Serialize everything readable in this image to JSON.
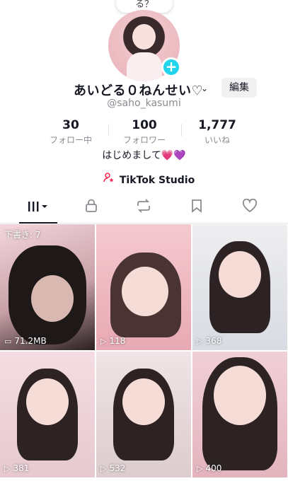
{
  "speech_bubble": "る？",
  "profile": {
    "display_name": "あいどる０ねんせい♡",
    "edit_label": "編集",
    "username": "@saho_kasumi",
    "bio_text": "はじめまして",
    "bio_heart1": "💗",
    "bio_heart2": "💜"
  },
  "stats": [
    {
      "value": "30",
      "label": "フォロー中"
    },
    {
      "value": "100",
      "label": "フォロワー"
    },
    {
      "value": "1,777",
      "label": "いいね"
    }
  ],
  "studio_label": "TikTok Studio",
  "tabs": [
    "videos",
    "private",
    "reposts",
    "favorites",
    "liked"
  ],
  "videos": [
    {
      "views": "71.2MB",
      "overlay": "下書き: 7",
      "type": "drafts"
    },
    {
      "views": "118"
    },
    {
      "views": "368"
    },
    {
      "views": "381"
    },
    {
      "views": "532"
    },
    {
      "views": "400"
    }
  ],
  "colors": {
    "accent_plus": "#20d5ec",
    "text_primary": "#161823",
    "text_secondary": "#8a8b91",
    "studio_icon": "#fe2c55"
  }
}
